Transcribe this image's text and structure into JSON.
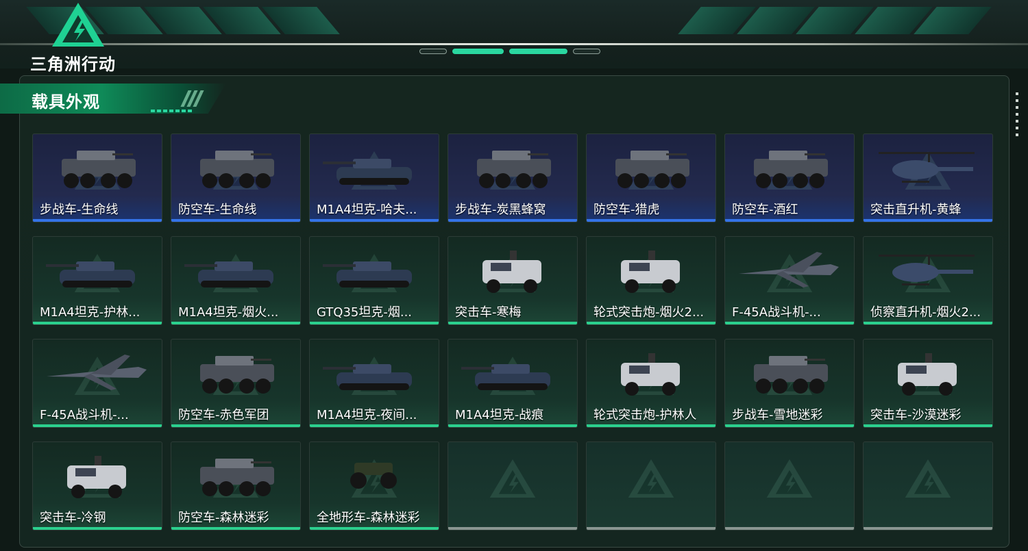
{
  "brand": {
    "logo_text": "三角洲行动"
  },
  "section": {
    "title": "载具外观"
  },
  "colors": {
    "accent": "#2ad7a0",
    "blue_bar": "#3473e8",
    "green_bar": "#2bd08e"
  },
  "items": [
    {
      "name": "步战车-生命线",
      "rarity": "blue",
      "kind": "apc"
    },
    {
      "name": "防空车-生命线",
      "rarity": "blue",
      "kind": "apc"
    },
    {
      "name": "M1A4坦克-哈夫...",
      "rarity": "blue",
      "kind": "tank"
    },
    {
      "name": "步战车-炭黑蜂窝",
      "rarity": "blue",
      "kind": "apc"
    },
    {
      "name": "防空车-猎虎",
      "rarity": "blue",
      "kind": "apc"
    },
    {
      "name": "防空车-酒红",
      "rarity": "blue",
      "kind": "apc"
    },
    {
      "name": "突击直升机-黄蜂",
      "rarity": "blue",
      "kind": "heli"
    },
    {
      "name": "M1A4坦克-护林...",
      "rarity": "green",
      "kind": "tank"
    },
    {
      "name": "M1A4坦克-烟火...",
      "rarity": "green",
      "kind": "tank"
    },
    {
      "name": "GTQ35坦克-烟...",
      "rarity": "green",
      "kind": "tank"
    },
    {
      "name": "突击车-寒梅",
      "rarity": "green",
      "kind": "truck"
    },
    {
      "name": "轮式突击炮-烟火2...",
      "rarity": "green",
      "kind": "truck"
    },
    {
      "name": "F-45A战斗机-...",
      "rarity": "green",
      "kind": "jet"
    },
    {
      "name": "侦察直升机-烟火2...",
      "rarity": "green",
      "kind": "heli"
    },
    {
      "name": "F-45A战斗机-...",
      "rarity": "green",
      "kind": "jet"
    },
    {
      "name": "防空车-赤色军团",
      "rarity": "green",
      "kind": "apc"
    },
    {
      "name": "M1A4坦克-夜间...",
      "rarity": "green",
      "kind": "tank"
    },
    {
      "name": "M1A4坦克-战痕",
      "rarity": "green",
      "kind": "tank"
    },
    {
      "name": "轮式突击炮-护林人",
      "rarity": "green",
      "kind": "truck"
    },
    {
      "name": "步战车-雪地迷彩",
      "rarity": "green",
      "kind": "apc"
    },
    {
      "name": "突击车-沙漠迷彩",
      "rarity": "green",
      "kind": "truck"
    },
    {
      "name": "突击车-冷钢",
      "rarity": "green",
      "kind": "truck"
    },
    {
      "name": "防空车-森林迷彩",
      "rarity": "green",
      "kind": "apc"
    },
    {
      "name": "全地形车-森林迷彩",
      "rarity": "green",
      "kind": "atv"
    },
    {
      "name": "",
      "rarity": "empty",
      "kind": "none"
    },
    {
      "name": "",
      "rarity": "empty",
      "kind": "none"
    },
    {
      "name": "",
      "rarity": "empty",
      "kind": "none"
    },
    {
      "name": "",
      "rarity": "empty",
      "kind": "none"
    }
  ]
}
